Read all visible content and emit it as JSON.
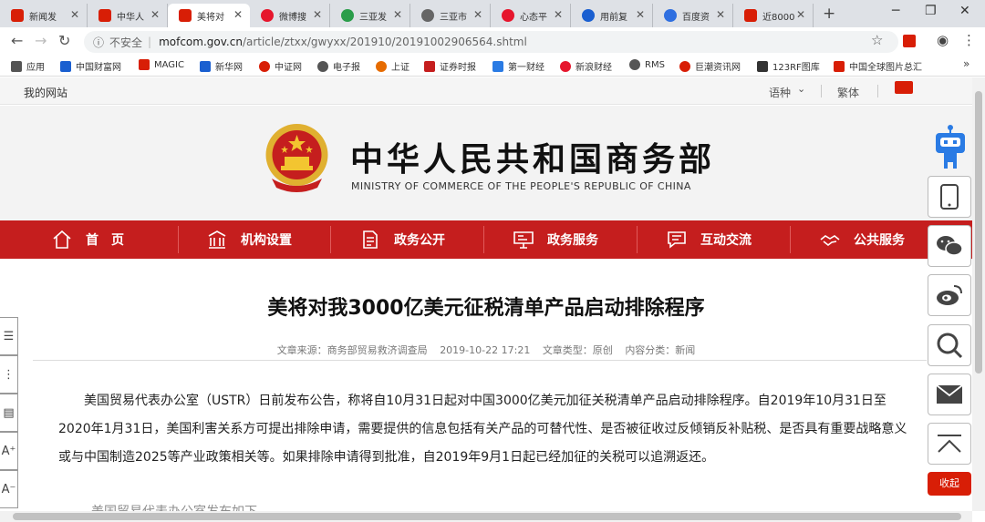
{
  "browser": {
    "tabs": [
      {
        "title": "新闻发",
        "favicon_color": "#d81e06"
      },
      {
        "title": "中华人",
        "favicon_color": "#d81e06"
      },
      {
        "title": "美将对",
        "favicon_color": "#d81e06",
        "active": true
      },
      {
        "title": "微博搜",
        "favicon_color": "#e6162d"
      },
      {
        "title": "三亚发",
        "favicon_color": "#2a9d4a"
      },
      {
        "title": "三亚市",
        "favicon_color": "#666666"
      },
      {
        "title": "心态平",
        "favicon_color": "#e6162d"
      },
      {
        "title": "用前复",
        "favicon_color": "#1a5fd0"
      },
      {
        "title": "百度资",
        "favicon_color": "#2f6fe0"
      },
      {
        "title": "近8000",
        "favicon_color": "#d81e06"
      }
    ],
    "new_tab": "+",
    "window_controls": [
      "─",
      "❐",
      "✕"
    ],
    "address": {
      "insecure_label": "不安全",
      "host": "mofcom.gov.cn",
      "path": "/article/ztxx/gwyxx/201910/20191002906564.shtml"
    },
    "bookmarks": [
      {
        "label": "应用",
        "color": "#555555"
      },
      {
        "label": "中国财富网",
        "color": "#1a5fd0"
      },
      {
        "label": "MAGIC",
        "color": "#d81e06"
      },
      {
        "label": "新华网",
        "color": "#1a5fd0"
      },
      {
        "label": "中证网",
        "color": "#d81e06"
      },
      {
        "label": "电子报",
        "color": "#555555"
      },
      {
        "label": "上证",
        "color": "#e66b00"
      },
      {
        "label": "证券时报",
        "color": "#c51e1e"
      },
      {
        "label": "第一财经",
        "color": "#2a7be4"
      },
      {
        "label": "新浪财经",
        "color": "#e6162d"
      },
      {
        "label": "RMS",
        "color": "#555555"
      },
      {
        "label": "巨潮资讯网",
        "color": "#d81e06"
      },
      {
        "label": "123RF图库",
        "color": "#333333"
      },
      {
        "label": "中国全球图片总汇",
        "color": "#d81e06"
      }
    ],
    "bookmarks_more": "»"
  },
  "site": {
    "topbar": {
      "my_site": "我的网站",
      "language": "语种",
      "traditional": "繁体"
    },
    "header": {
      "title_zh": "中华人民共和国商务部",
      "title_en": "MINISTRY OF COMMERCE OF THE PEOPLE'S REPUBLIC OF CHINA"
    },
    "nav": [
      {
        "label": "首　页",
        "icon": "home-icon"
      },
      {
        "label": "机构设置",
        "icon": "building-icon"
      },
      {
        "label": "政务公开",
        "icon": "document-icon"
      },
      {
        "label": "政务服务",
        "icon": "monitor-icon"
      },
      {
        "label": "互动交流",
        "icon": "chat-icon"
      },
      {
        "label": "公共服务",
        "icon": "handshake-icon"
      }
    ],
    "article": {
      "title": "美将对我3000亿美元征税清单产品启动排除程序",
      "source": "文章来源：商务部贸易救济调查局",
      "date": "2019-10-22 17:21",
      "type": "文章类型：原创",
      "category": "内容分类：新闻",
      "paragraph": "美国贸易代表办公室（USTR）日前发布公告，称将自10月31日起对中国3000亿美元加征关税清单产品启动排除程序。自2019年10月31日至2020年1月31日，美国利害关系方可提出排除申请，需要提供的信息包括有关产品的可替代性、是否被征收过反倾销反补贴税、是否具有重要战略意义或与中国制造2025等产业政策相关等。如果排除申请得到批准，自2019年9月1日起已经加征的关税可以追溯返还。",
      "next_paragraph_partial": "美国贸易代表办公室发布如下"
    },
    "left_tools": [
      "☰",
      "⋮",
      "▤",
      "A⁺",
      "A⁻"
    ],
    "right_tools": [
      "mobile-icon",
      "wechat-icon",
      "weibo-icon",
      "search-icon",
      "mail-icon",
      "back-to-top-icon"
    ],
    "collapse_label": "收起"
  }
}
